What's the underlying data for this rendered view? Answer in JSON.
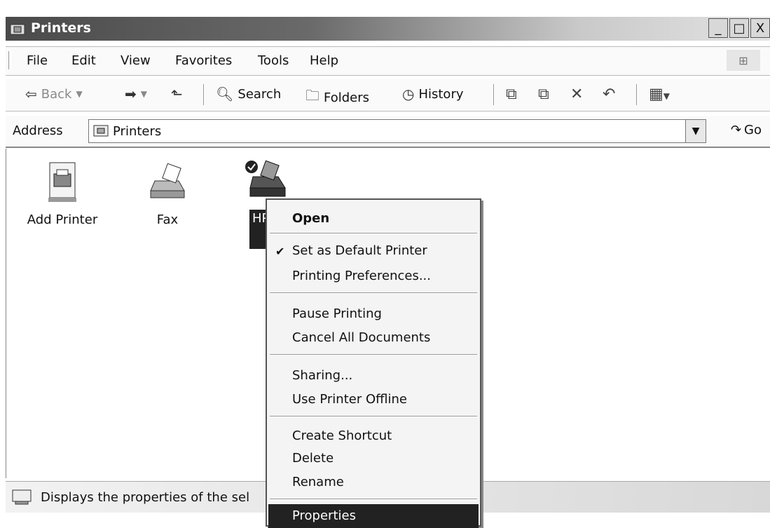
{
  "window": {
    "title": "Printers",
    "controls": [
      "_",
      "□",
      "X"
    ]
  },
  "menubar": {
    "items": [
      "File",
      "Edit",
      "View",
      "Favorites",
      "Tools",
      "Help"
    ]
  },
  "toolbar": {
    "back": "Back",
    "search": "Search",
    "folders": "Folders",
    "history": "History"
  },
  "address": {
    "label": "Address",
    "value": "Printers",
    "go": "Go"
  },
  "items": [
    {
      "label": "Add Printer"
    },
    {
      "label": "Fax"
    },
    {
      "label": "HP L"
    }
  ],
  "context_menu": {
    "open": "Open",
    "set_default": "Set as Default Printer",
    "preferences": "Printing Preferences...",
    "pause": "Pause Printing",
    "cancel_all": "Cancel All Documents",
    "sharing": "Sharing...",
    "offline": "Use Printer Offline",
    "shortcut": "Create Shortcut",
    "delete": "Delete",
    "rename": "Rename",
    "properties": "Properties"
  },
  "status": {
    "text": "Displays the properties of the sel"
  }
}
